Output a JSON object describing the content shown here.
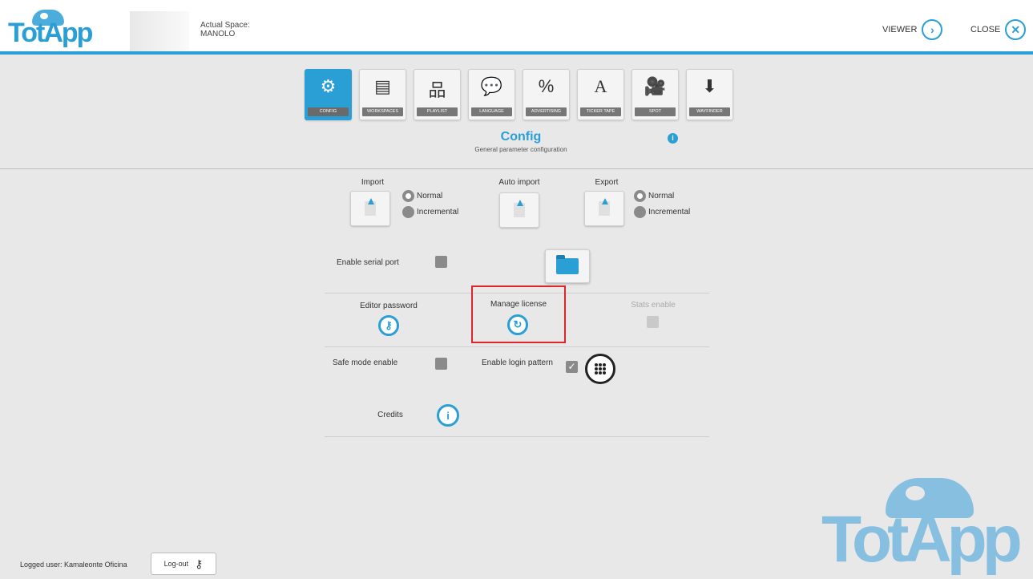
{
  "header": {
    "logo_text": "TotApp",
    "space_label": "Actual Space:",
    "space_name": "MANOLO",
    "viewer_label": "VIEWER",
    "close_label": "CLOSE"
  },
  "tabs": [
    {
      "label": "CONFIG",
      "icon": "gear-icon",
      "glyph": "⚙",
      "active": true
    },
    {
      "label": "WORKSPACES",
      "icon": "workspaces-icon",
      "glyph": "▤",
      "active": false
    },
    {
      "label": "PLAYLIST",
      "icon": "sitemap-icon",
      "glyph": "品",
      "active": false
    },
    {
      "label": "LANGUAGE",
      "icon": "speech-bubble-icon",
      "glyph": "💬",
      "active": false
    },
    {
      "label": "ADVERTISING",
      "icon": "price-tag-icon",
      "glyph": "%",
      "active": false
    },
    {
      "label": "TICKER TAPE",
      "icon": "text-ticker-icon",
      "glyph": "A",
      "active": false
    },
    {
      "label": "SPOT",
      "icon": "film-camera-icon",
      "glyph": "🎥",
      "active": false
    },
    {
      "label": "WAYFINDER",
      "icon": "map-pin-icon",
      "glyph": "⬇",
      "active": false
    }
  ],
  "page": {
    "title": "Config",
    "subtitle": "General parameter configuration"
  },
  "import": {
    "label": "Import",
    "normal": "Normal",
    "incremental": "Incremental"
  },
  "auto_import": {
    "label": "Auto import"
  },
  "export": {
    "label": "Export",
    "normal": "Normal",
    "incremental": "Incremental"
  },
  "settings": {
    "serial_port": "Enable serial port",
    "editor_password": "Editor password",
    "manage_license": "Manage license",
    "stats_enable": "Stats enable",
    "safe_mode": "Safe mode enable",
    "login_pattern": "Enable login pattern",
    "credits": "Credits"
  },
  "footer": {
    "logged_user": "Logged user: Kamaleonte Oficina",
    "logout": "Log-out"
  }
}
